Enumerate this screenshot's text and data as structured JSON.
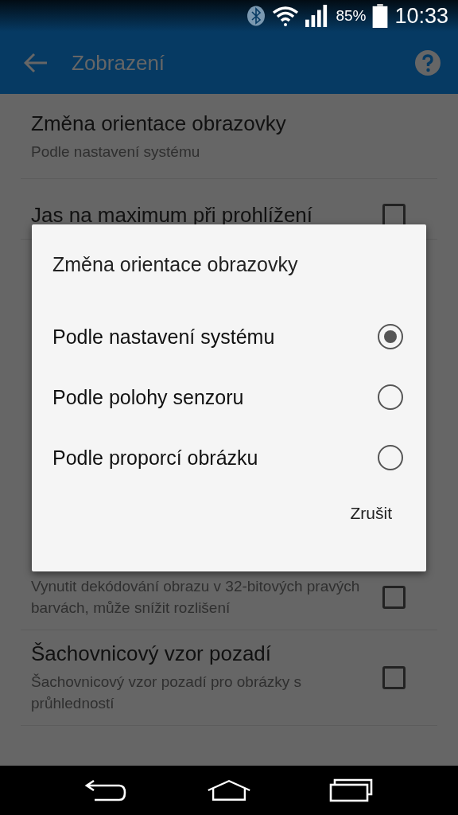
{
  "status_bar": {
    "battery": "85%",
    "time": "10:33"
  },
  "app_bar": {
    "title": "Zobrazení"
  },
  "settings": [
    {
      "kind": "summary",
      "title": "Změna orientace obrazovky",
      "summary": "Podle nastavení systému"
    },
    {
      "kind": "checkbox",
      "title": "Jas na maximum při prohlížení",
      "checked": false
    },
    {
      "kind": "checkbox",
      "summary": "Vynutit dekódování obrazu v 32-bitových pravých barvách, může snížit rozlišení",
      "checked": false
    },
    {
      "kind": "checkbox",
      "title": "Šachovnicový vzor pozadí",
      "summary": "Šachovnicový vzor pozadí pro obrázky s průhledností",
      "checked": false
    }
  ],
  "dialog": {
    "title": "Změna orientace obrazovky",
    "options": [
      {
        "label": "Podle nastavení systému",
        "selected": true
      },
      {
        "label": "Podle polohy senzoru",
        "selected": false
      },
      {
        "label": "Podle proporcí obrázku",
        "selected": false
      }
    ],
    "buttons": [
      "Zrušit"
    ]
  }
}
